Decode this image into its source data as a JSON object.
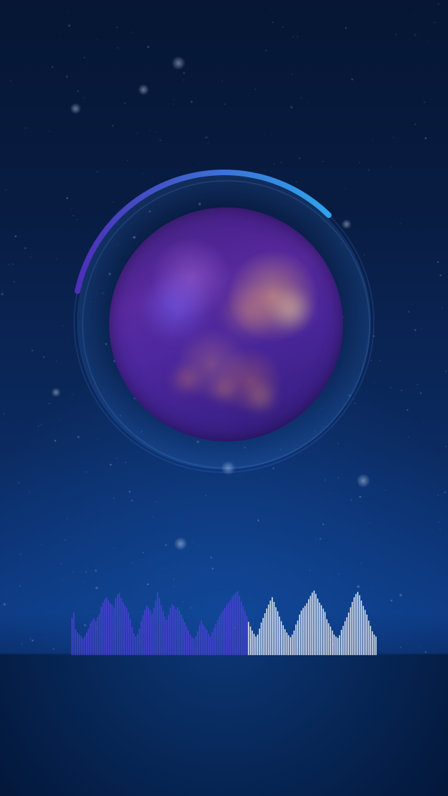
{
  "screen": {
    "background_top": "#061634",
    "background_mid": "#0d3a82",
    "background_bottom": "#03183b"
  },
  "player": {
    "artwork_description": "blurred-album-art",
    "progress": 0.34,
    "progress_track_color": "rgba(122,170,255,0.22)",
    "progress_start_color": "#4d2fb8",
    "progress_end_color": "#2ea4ec"
  },
  "visualizer": {
    "played_fraction": 0.58,
    "played_color": "#4d41d8",
    "unplayed_color": "#ffffff",
    "levels": [
      0.56,
      0.64,
      0.39,
      0.34,
      0.31,
      0.29,
      0.25,
      0.28,
      0.34,
      0.4,
      0.48,
      0.52,
      0.55,
      0.51,
      0.57,
      0.62,
      0.73,
      0.79,
      0.84,
      0.87,
      0.82,
      0.78,
      0.76,
      0.72,
      0.86,
      0.91,
      0.93,
      0.86,
      0.8,
      0.75,
      0.71,
      0.64,
      0.54,
      0.42,
      0.33,
      0.28,
      0.32,
      0.4,
      0.51,
      0.6,
      0.68,
      0.75,
      0.72,
      0.67,
      0.62,
      0.71,
      0.82,
      0.95,
      0.86,
      0.75,
      0.66,
      0.58,
      0.53,
      0.6,
      0.71,
      0.77,
      0.74,
      0.69,
      0.72,
      0.67,
      0.61,
      0.55,
      0.49,
      0.43,
      0.37,
      0.31,
      0.27,
      0.25,
      0.29,
      0.36,
      0.45,
      0.52,
      0.46,
      0.42,
      0.38,
      0.32,
      0.28,
      0.35,
      0.41,
      0.47,
      0.53,
      0.58,
      0.63,
      0.67,
      0.71,
      0.76,
      0.79,
      0.83,
      0.88,
      0.91,
      0.94,
      0.96,
      0.89,
      0.81,
      0.74,
      0.66,
      0.59,
      0.5,
      0.43,
      0.37,
      0.32,
      0.28,
      0.31,
      0.4,
      0.49,
      0.56,
      0.63,
      0.7,
      0.76,
      0.82,
      0.87,
      0.8,
      0.72,
      0.66,
      0.58,
      0.51,
      0.45,
      0.39,
      0.34,
      0.3,
      0.27,
      0.31,
      0.37,
      0.46,
      0.52,
      0.61,
      0.67,
      0.71,
      0.74,
      0.78,
      0.84,
      0.89,
      0.94,
      0.97,
      0.92,
      0.85,
      0.79,
      0.75,
      0.7,
      0.65,
      0.54,
      0.48,
      0.43,
      0.37,
      0.31,
      0.28,
      0.26,
      0.3,
      0.38,
      0.44,
      0.51,
      0.57,
      0.64,
      0.72,
      0.8,
      0.87,
      0.92,
      0.95,
      0.9,
      0.82,
      0.74,
      0.68,
      0.61,
      0.52,
      0.44,
      0.36,
      0.31,
      0.28
    ]
  }
}
